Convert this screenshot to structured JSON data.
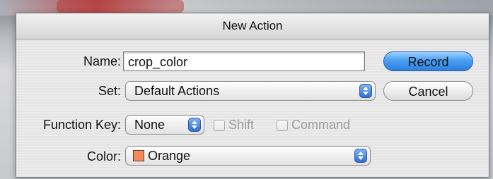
{
  "dialog": {
    "title": "New Action"
  },
  "form": {
    "name_label": "Name:",
    "name_value": "crop_color",
    "set_label": "Set:",
    "set_value": "Default Actions",
    "function_key_label": "Function Key:",
    "function_key_value": "None",
    "shift_label": "Shift",
    "command_label": "Command",
    "color_label": "Color:",
    "color_value": "Orange",
    "color_swatch": "#f28a5a"
  },
  "buttons": {
    "record_label": "Record",
    "cancel_label": "Cancel"
  }
}
